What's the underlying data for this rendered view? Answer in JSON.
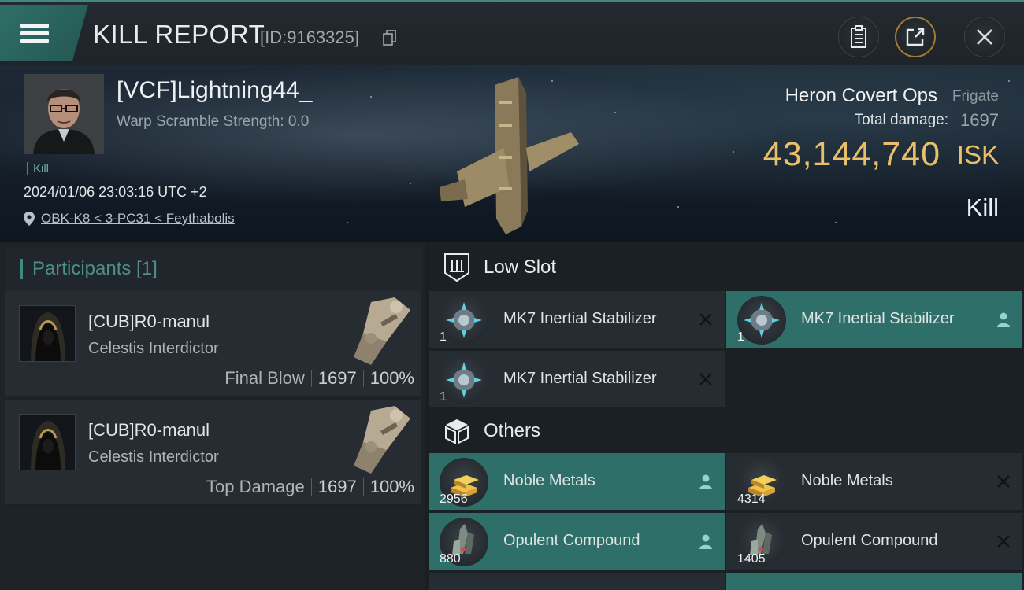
{
  "header": {
    "title": "KILL REPORT",
    "report_id": "[ID:9163325]",
    "icons": [
      "menu-icon",
      "copy-icon",
      "clipboard-icon",
      "share-icon",
      "close-icon"
    ]
  },
  "victim": {
    "name": "[VCF]Lightning44_",
    "warp_scramble": "Warp Scramble Strength: 0.0",
    "kill_tag": "Kill",
    "datetime": "2024/01/06 23:03:16 UTC +2",
    "location": "OBK-K8 < 3-PC31 < Feythabolis",
    "ship_name": "Heron Covert Ops",
    "ship_class": "Frigate",
    "total_damage_label": "Total damage:",
    "total_damage_value": "1697",
    "isk_value": "43,144,740",
    "isk_unit": "ISK",
    "result": "Kill"
  },
  "participants": {
    "header": "Participants [1]",
    "items": [
      {
        "name": "[CUB]R0-manul",
        "ship": "Celestis Interdictor",
        "role": "Final Blow",
        "damage": "1697",
        "percent": "100%"
      },
      {
        "name": "[CUB]R0-manul",
        "ship": "Celestis Interdictor",
        "role": "Top Damage",
        "damage": "1697",
        "percent": "100%"
      }
    ]
  },
  "slots": {
    "low_slot": {
      "label": "Low Slot",
      "items": [
        {
          "name": "MK7 Inertial Stabilizer",
          "qty": "1",
          "status": "destroyed"
        },
        {
          "name": "MK7 Inertial Stabilizer",
          "qty": "1",
          "status": "dropped"
        },
        {
          "name": "MK7 Inertial Stabilizer",
          "qty": "1",
          "status": "destroyed"
        }
      ]
    },
    "others": {
      "label": "Others",
      "items": [
        {
          "name": "Noble Metals",
          "qty": "2956",
          "status": "dropped"
        },
        {
          "name": "Noble Metals",
          "qty": "4314",
          "status": "destroyed"
        },
        {
          "name": "Opulent Compound",
          "qty": "880",
          "status": "dropped"
        },
        {
          "name": "Opulent Compound",
          "qty": "1405",
          "status": "destroyed"
        }
      ]
    }
  },
  "colors": {
    "accent": "#3e8a83",
    "highlight": "#2f6f69",
    "isk": "#e8c06a",
    "share_ring": "#a57a34"
  }
}
